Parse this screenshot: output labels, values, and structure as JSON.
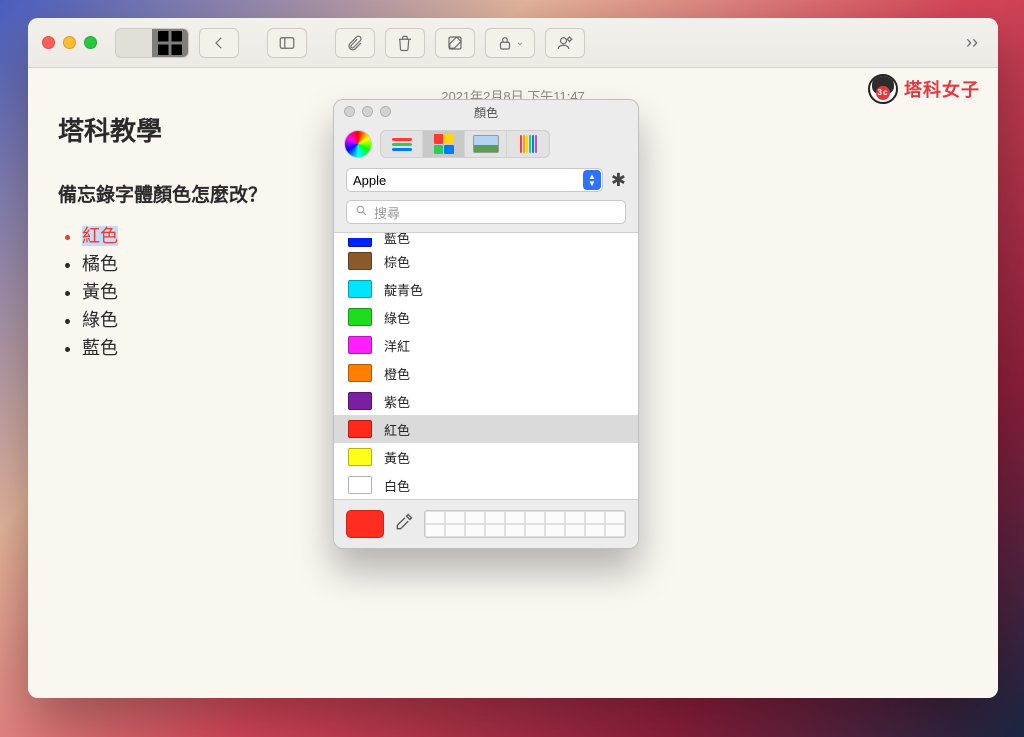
{
  "note": {
    "timestamp": "2021年2月8日 下午11:47",
    "title": "塔科教學",
    "subtitle": "備忘錄字體顏色怎麼改？",
    "items": [
      {
        "label": "紅色",
        "red": true,
        "selected": true
      },
      {
        "label": "橘色"
      },
      {
        "label": "黃色"
      },
      {
        "label": "綠色"
      },
      {
        "label": "藍色"
      }
    ]
  },
  "watermark_text": "塔科女子",
  "color_panel": {
    "title": "顏色",
    "palette_name": "Apple",
    "search_placeholder": "搜尋",
    "selected_index": 7,
    "current_color": "#ff2c1f",
    "colors": [
      {
        "name": "藍色",
        "hex": "#0022ff",
        "cut": true
      },
      {
        "name": "棕色",
        "hex": "#8b5a2b"
      },
      {
        "name": "靛青色",
        "hex": "#00e5ff"
      },
      {
        "name": "綠色",
        "hex": "#1edd1e"
      },
      {
        "name": "洋紅",
        "hex": "#ff1fff"
      },
      {
        "name": "橙色",
        "hex": "#ff7f00"
      },
      {
        "name": "紫色",
        "hex": "#7a1fa2"
      },
      {
        "name": "紅色",
        "hex": "#ff2a1a"
      },
      {
        "name": "黃色",
        "hex": "#ffff1a"
      },
      {
        "name": "白色",
        "hex": "#ffffff"
      }
    ]
  }
}
